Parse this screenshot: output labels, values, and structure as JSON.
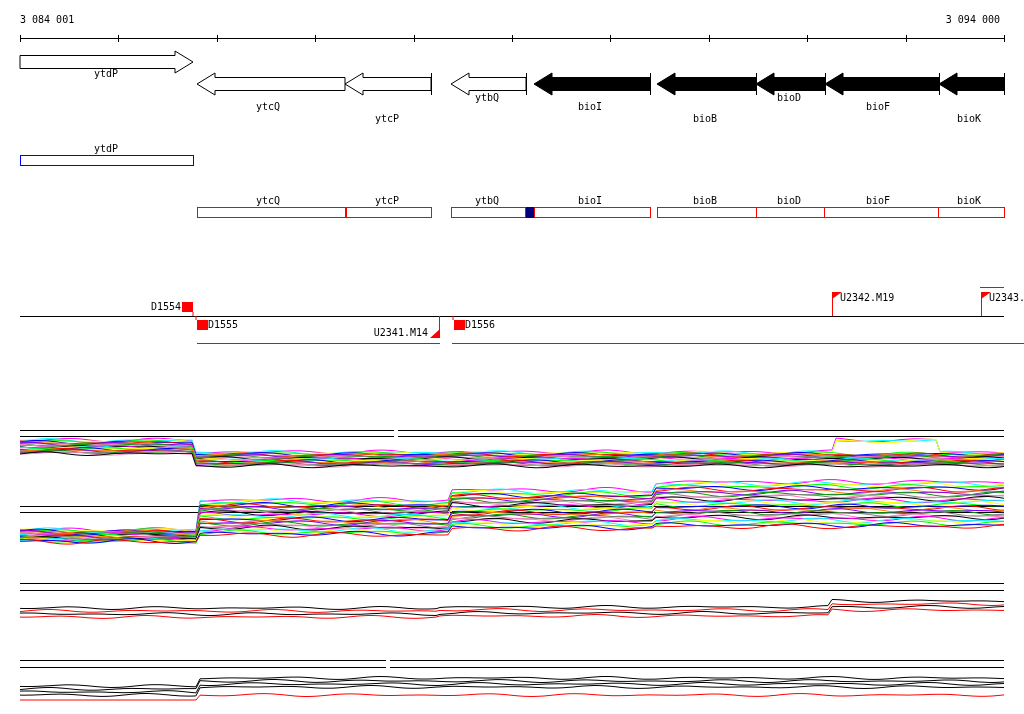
{
  "ruler": {
    "start_label": "3 084 001",
    "end_label": "3 094 000"
  },
  "genes": [
    {
      "label": "ytdP",
      "forward": true,
      "filled": false
    },
    {
      "label": "ytcQ",
      "forward": false,
      "filled": false
    },
    {
      "label": "ytcP",
      "forward": false,
      "filled": false
    },
    {
      "label": "ytbQ",
      "forward": false,
      "filled": false
    },
    {
      "label": "bioI",
      "forward": false,
      "filled": true
    },
    {
      "label": "bioB",
      "forward": false,
      "filled": true
    },
    {
      "label": "bioD",
      "forward": false,
      "filled": true
    },
    {
      "label": "bioF",
      "forward": false,
      "filled": true
    },
    {
      "label": "bioK",
      "forward": false,
      "filled": true
    }
  ],
  "annotations": [
    {
      "label": "ytdP",
      "color": "#0000ff"
    },
    {
      "label": "ytcQ",
      "color": "#ff0000"
    },
    {
      "label": "ytcP",
      "color": "#ff0000"
    },
    {
      "label": "ytbQ",
      "color": "#ff0000"
    },
    {
      "label": "bioI",
      "color": "#ff0000"
    },
    {
      "label": "bioB",
      "color": "#ff0000"
    },
    {
      "label": "bioD",
      "color": "#ff0000"
    },
    {
      "label": "bioF",
      "color": "#ff0000"
    },
    {
      "label": "bioK",
      "color": "#ff0000"
    }
  ],
  "markers": [
    {
      "label": "D1554",
      "kind": "square"
    },
    {
      "label": "D1555",
      "kind": "square"
    },
    {
      "label": "U2341.M14",
      "kind": "triangle"
    },
    {
      "label": "D1556",
      "kind": "square"
    },
    {
      "label": "U2342.M19",
      "kind": "flag"
    },
    {
      "label": "U2343.",
      "kind": "flag"
    }
  ]
}
